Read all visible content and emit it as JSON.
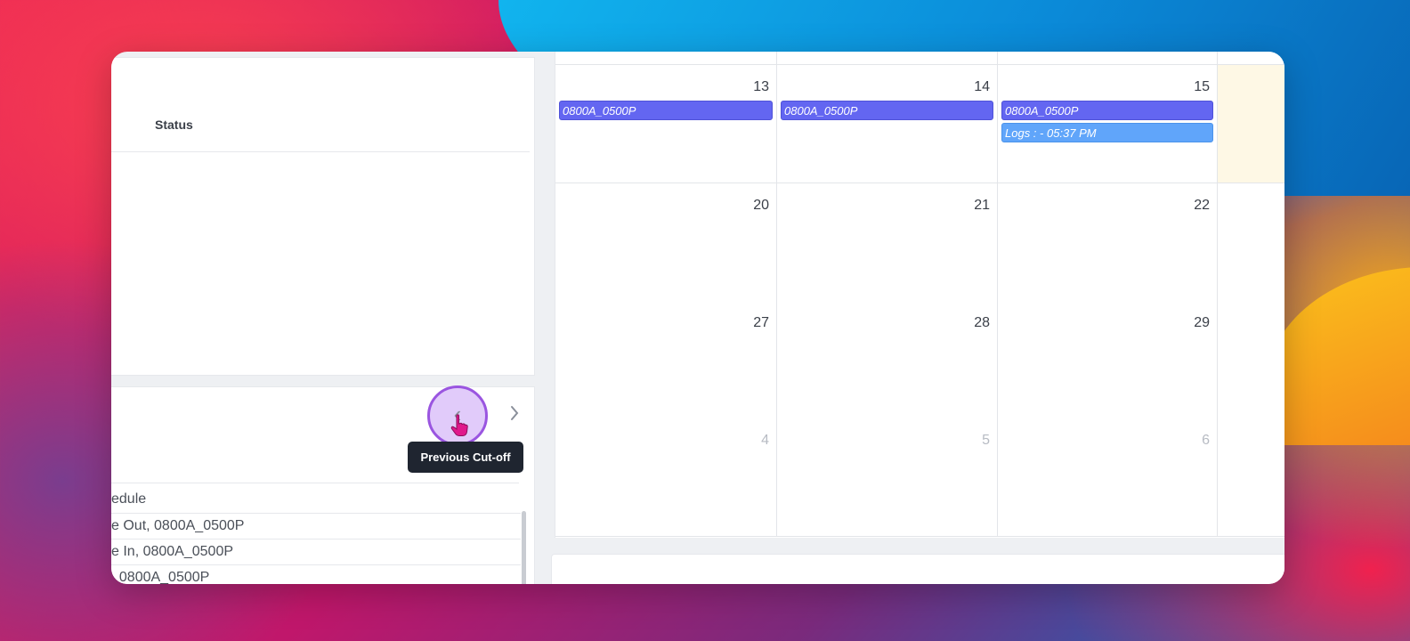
{
  "table": {
    "status_header": "Status"
  },
  "cutoff": {
    "prev_tooltip": "Previous Cut-off",
    "schedule_header": "edule",
    "rows": [
      {
        "text": "e Out, 0800A_0500P"
      },
      {
        "text": "e In, 0800A_0500P"
      },
      {
        "text": ", 0800A_0500P"
      }
    ]
  },
  "calendar": {
    "weeks": [
      [
        {
          "day": "13",
          "events": [
            {
              "type": "shift",
              "label": "0800A_0500P"
            }
          ]
        },
        {
          "day": "14",
          "events": [
            {
              "type": "shift",
              "label": "0800A_0500P"
            }
          ]
        },
        {
          "day": "15",
          "events": [
            {
              "type": "shift",
              "label": "0800A_0500P"
            },
            {
              "type": "log",
              "label": "Logs : - 05:37 PM"
            }
          ]
        },
        {
          "day": "",
          "today": true,
          "events": []
        }
      ],
      [
        {
          "day": "20",
          "events": []
        },
        {
          "day": "21",
          "events": []
        },
        {
          "day": "22",
          "events": []
        },
        {
          "day": "",
          "events": []
        }
      ],
      [
        {
          "day": "27",
          "events": []
        },
        {
          "day": "28",
          "events": []
        },
        {
          "day": "29",
          "events": []
        },
        {
          "day": "",
          "events": []
        }
      ],
      [
        {
          "day": "4",
          "muted": true,
          "events": []
        },
        {
          "day": "5",
          "muted": true,
          "events": []
        },
        {
          "day": "6",
          "muted": true,
          "events": []
        },
        {
          "day": "",
          "events": []
        }
      ]
    ]
  },
  "colors": {
    "shift_event": "#6366f1",
    "log_event": "#60a5fa",
    "today_cell": "#fef8e5",
    "tooltip_bg": "#1f2530",
    "highlight_ring": "#9a55e0"
  },
  "icons": {
    "prev": "chevron-left-icon",
    "next": "chevron-right-icon",
    "cursor": "hand-pointer-icon"
  }
}
